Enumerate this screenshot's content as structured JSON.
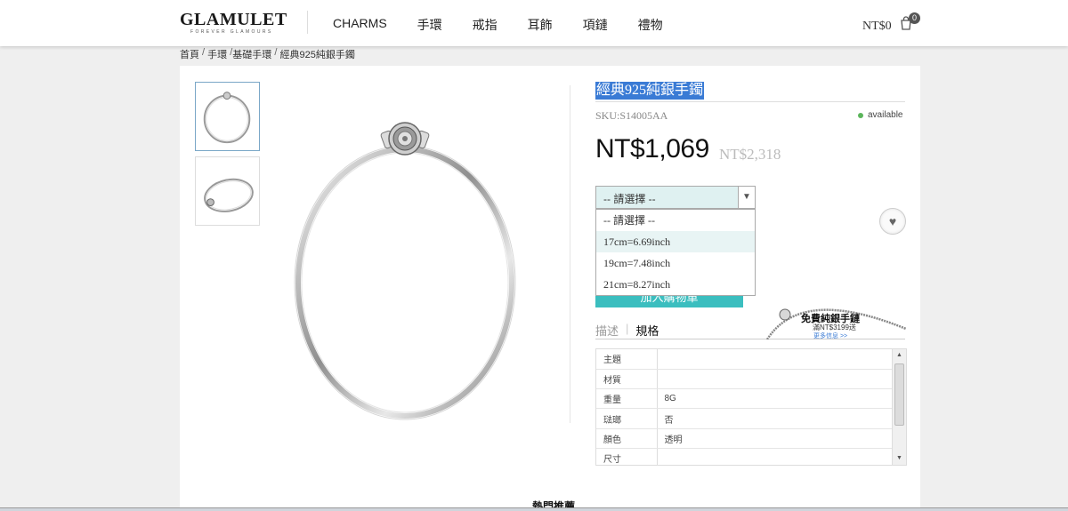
{
  "header": {
    "logo": "GLAMULET",
    "logo_tagline": "FOREVER GLAMOURS",
    "nav": [
      "CHARMS",
      "手環",
      "戒指",
      "耳飾",
      "項鏈",
      "禮物"
    ],
    "cart_total": "NT$0",
    "cart_count": "0",
    "cart_icon": "shopping-bag-icon"
  },
  "breadcrumb": [
    "首頁",
    "手環",
    "基礎手環",
    "經典925純銀手鐲"
  ],
  "product": {
    "title": "經典925純銀手鐲",
    "sku": "SKU:S14005AA",
    "availability": "available",
    "price": "NT$1,069",
    "original_price": "NT$2,318",
    "select": {
      "selected": "-- 請選擇 --",
      "options": [
        "-- 請選擇 --",
        "17cm=6.69inch",
        "19cm=7.48inch",
        "21cm=8.27inch"
      ]
    },
    "add_to_cart": "加入購物車",
    "wishlist_icon": "heart-icon"
  },
  "tabs": [
    "描述",
    "規格"
  ],
  "promo": {
    "title": "免費純銀手鏈",
    "subtitle": "滿NT$3199送",
    "link": "更多信息 >>"
  },
  "specs": [
    {
      "key": "主題",
      "value": ""
    },
    {
      "key": "材質",
      "value": ""
    },
    {
      "key": "重量",
      "value": "8G"
    },
    {
      "key": "琺瑯",
      "value": "否"
    },
    {
      "key": "顏色",
      "value": "透明"
    },
    {
      "key": "尺寸",
      "value": ""
    }
  ],
  "section_title": "熱門推薦",
  "colors": {
    "accent": "#3bbebf",
    "selection": "#3a7bd5",
    "available": "#5bb55b"
  }
}
